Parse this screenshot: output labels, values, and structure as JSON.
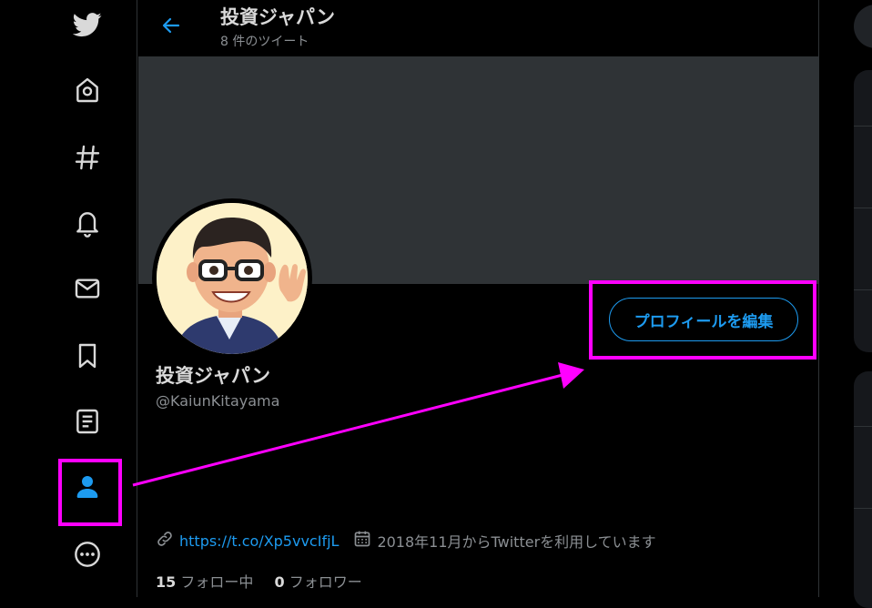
{
  "nav": {
    "items": [
      {
        "id": "home",
        "icon": "twitter-logo-icon"
      },
      {
        "id": "home",
        "icon": "home-icon"
      },
      {
        "id": "explore",
        "icon": "hashtag-icon"
      },
      {
        "id": "notifications",
        "icon": "bell-icon"
      },
      {
        "id": "messages",
        "icon": "envelope-icon"
      },
      {
        "id": "bookmarks",
        "icon": "bookmark-icon"
      },
      {
        "id": "lists",
        "icon": "list-icon"
      },
      {
        "id": "profile",
        "icon": "person-icon",
        "active": true
      },
      {
        "id": "more",
        "icon": "more-circle-icon"
      }
    ]
  },
  "header": {
    "title": "投資ジャパン",
    "subtitle": "8 件のツイート"
  },
  "profile": {
    "name": "投資ジャパン",
    "handle": "@KaiunKitayama",
    "edit_button": "プロフィールを編集",
    "link": "https://t.co/Xp5vvcIfjL",
    "joined": "2018年11月からTwitterを利用しています",
    "following_count": "15",
    "following_label": "フォロー中",
    "followers_count": "0",
    "followers_label": "フォロワー"
  },
  "colors": {
    "accent": "#1d9bf0",
    "highlight": "#ff00ff",
    "background": "#000000",
    "banner": "#2f3336"
  }
}
